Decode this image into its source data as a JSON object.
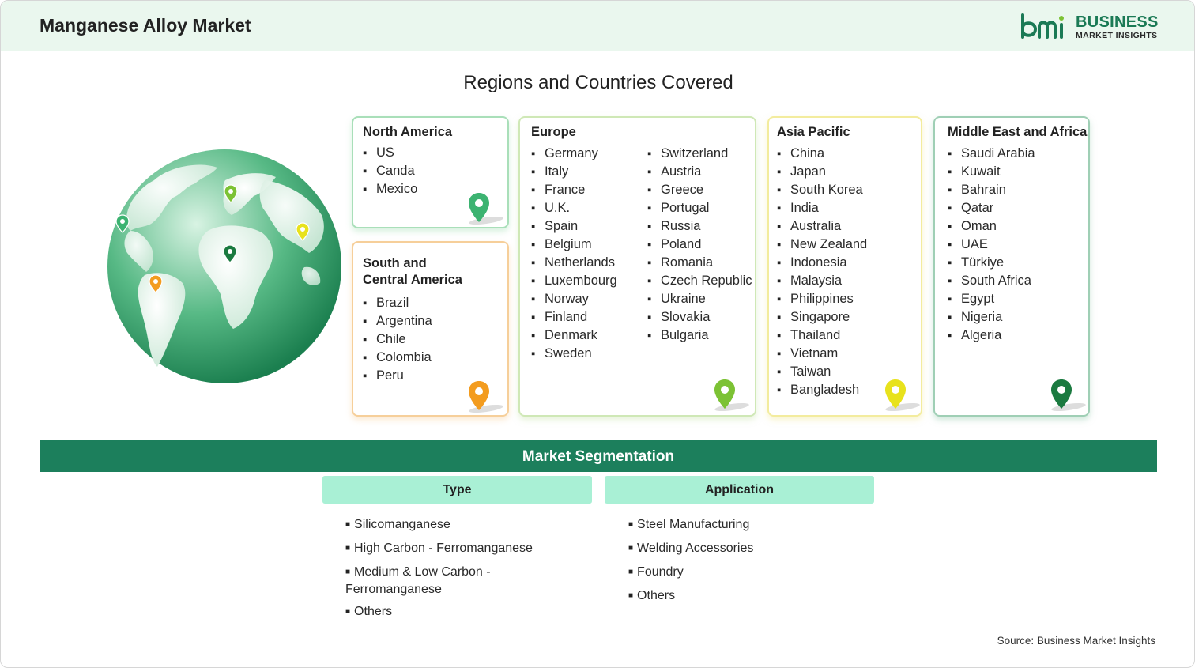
{
  "header": {
    "title": "Manganese Alloy Market",
    "logo_word": "BUSINESS",
    "logo_sub": "MARKET INSIGHTS"
  },
  "regions_title": "Regions and Countries Covered",
  "regions": {
    "north_america": {
      "title": "North America",
      "items": [
        "US",
        "Canda",
        "Mexico"
      ],
      "color": "#3cb371"
    },
    "south_america": {
      "title": "South and Central America",
      "title_line1": "South and",
      "title_line2": "Central America",
      "items": [
        "Brazil",
        "Argentina",
        "Chile",
        "Colombia",
        "Peru"
      ],
      "color": "#f39c1f"
    },
    "europe": {
      "title": "Europe",
      "col1": [
        "Germany",
        "Italy",
        "France",
        "U.K.",
        "Spain",
        "Belgium",
        "Netherlands",
        "Luxembourg",
        "Norway",
        "Finland",
        "Denmark",
        "Sweden"
      ],
      "col2": [
        "Switzerland",
        "Austria",
        "Greece",
        "Portugal",
        "Russia",
        "Poland",
        "Romania",
        "Czech Republic",
        "Ukraine",
        "Slovakia",
        "Bulgaria"
      ],
      "color": "#7cc234"
    },
    "asia_pacific": {
      "title": "Asia Pacific",
      "items": [
        "China",
        "Japan",
        "South Korea",
        "India",
        "Australia",
        "New Zealand",
        "Indonesia",
        "Malaysia",
        "Philippines",
        "Singapore",
        "Thailand",
        "Vietnam",
        "Taiwan",
        "Bangladesh"
      ],
      "color": "#e8e21c"
    },
    "middle_east_africa": {
      "title": "Middle East and Africa",
      "items": [
        "Saudi Arabia",
        "Kuwait",
        "Bahrain",
        "Qatar",
        "Oman",
        "UAE",
        "Türkiye",
        "South Africa",
        "Egypt",
        "Nigeria",
        "Algeria"
      ],
      "color": "#1b7a40"
    }
  },
  "segmentation": {
    "title": "Market Segmentation",
    "type": {
      "title": "Type",
      "items": [
        "Silicomanganese",
        "High Carbon - Ferromanganese",
        "Medium & Low Carbon - Ferromanganese",
        "Others"
      ]
    },
    "application": {
      "title": "Application",
      "items": [
        "Steel Manufacturing",
        "Welding Accessories",
        "Foundry",
        "Others"
      ]
    }
  },
  "source": "Source: Business Market Insights",
  "colors": {
    "brand": "#1c7f5c",
    "header_bg": "#eaf7ee",
    "segment_head": "#a9f0d5"
  }
}
